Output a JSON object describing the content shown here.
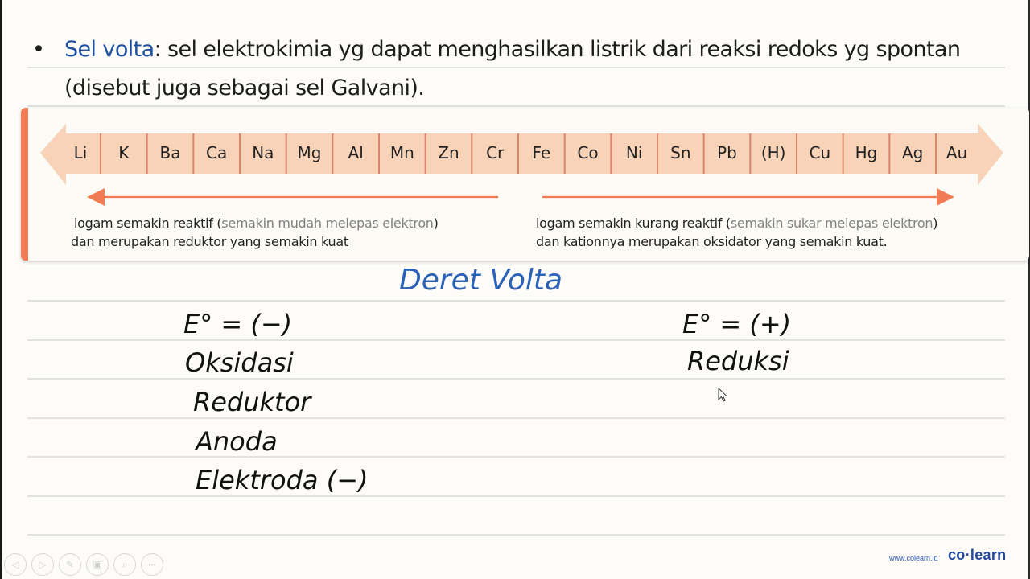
{
  "slide": {
    "bullet": {
      "term": "Sel volta",
      "line1_rest": ": sel elektrokimia yg dapat menghasilkan listrik dari reaksi redoks yg spontan",
      "line2": "(disebut juga sebagai sel Galvani)."
    },
    "volta_series": {
      "elements": [
        "Li",
        "K",
        "Ba",
        "Ca",
        "Na",
        "Mg",
        "Al",
        "Mn",
        "Zn",
        "Cr",
        "Fe",
        "Co",
        "Ni",
        "Sn",
        "Pb",
        "(H)",
        "Cu",
        "Hg",
        "Ag",
        "Au"
      ],
      "left_description": {
        "line1_a": "logam semakin reaktif (",
        "line1_muted": "semakin mudah melepas elektron",
        "line1_b": ")",
        "line2": "dan merupakan reduktor yang semakin kuat"
      },
      "right_description": {
        "line1_a": "logam semakin kurang reaktif (",
        "line1_muted": "semakin sukar melepas elektron",
        "line1_b": ")",
        "line2": "dan kationnya merupakan oksidator yang semakin kuat."
      }
    },
    "handwriting": {
      "title": "Deret Volta",
      "left": [
        "E° = (−)",
        "Oksidasi",
        "Reduktor",
        "Anoda",
        "Elektroda (−)"
      ],
      "right": [
        "E° = (+)",
        "Reduksi"
      ]
    }
  },
  "player_controls": [
    {
      "name": "previous",
      "glyph": "◁"
    },
    {
      "name": "next",
      "glyph": "▷"
    },
    {
      "name": "pen",
      "glyph": "✎"
    },
    {
      "name": "slides",
      "glyph": "▣"
    },
    {
      "name": "zoom",
      "glyph": "⌕"
    },
    {
      "name": "more",
      "glyph": "•••"
    }
  ],
  "branding": {
    "url": "www.colearn.id",
    "logo": "co·learn"
  },
  "colors": {
    "accent_blue": "#1f4fa0",
    "arrow_fill": "#f9d3b8",
    "arrow_line": "#f07b55",
    "separator": "#d9866a",
    "handwriting_blue": "#2a62b8"
  }
}
